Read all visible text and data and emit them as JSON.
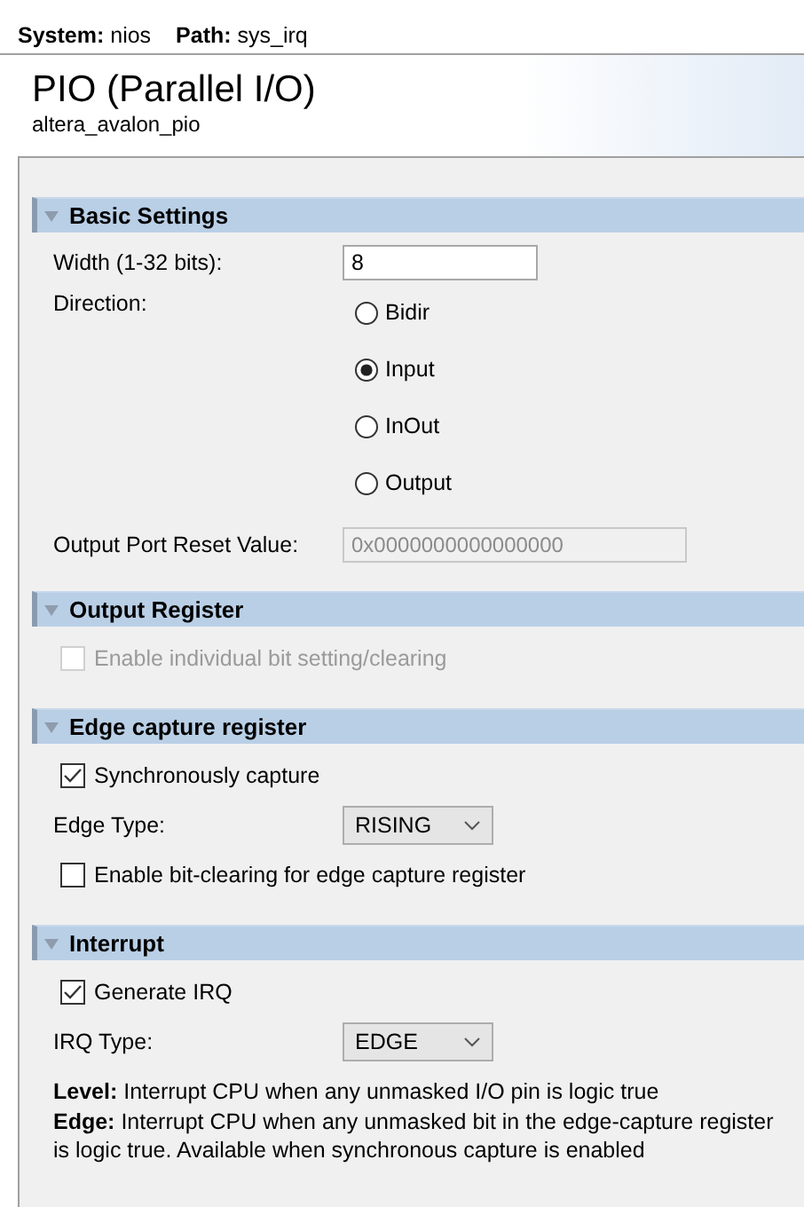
{
  "breadcrumb": [
    {
      "label": "System:",
      "value": "nios"
    },
    {
      "label": "Path:",
      "value": "sys_irq"
    }
  ],
  "component": {
    "title": "PIO (Parallel I/O)",
    "subtitle": "altera_avalon_pio"
  },
  "sections": [
    {
      "title": "Basic Settings",
      "expanded": true,
      "items": [
        {
          "kind": "text",
          "label": "Width (1-32 bits):",
          "value": "8",
          "disabled": false
        },
        {
          "kind": "radio",
          "label": "Direction:",
          "options": [
            {
              "label": "Bidir",
              "selected": false
            },
            {
              "label": "Input",
              "selected": true
            },
            {
              "label": "InOut",
              "selected": false
            },
            {
              "label": "Output",
              "selected": false
            }
          ]
        },
        {
          "kind": "text",
          "label": "Output Port Reset Value:",
          "value": "0x0000000000000000",
          "disabled": true
        }
      ]
    },
    {
      "title": "Output Register",
      "expanded": true,
      "items": [
        {
          "kind": "checkbox",
          "label": "Enable individual bit setting/clearing",
          "checked": false,
          "disabled": true
        }
      ]
    },
    {
      "title": "Edge capture register",
      "expanded": true,
      "items": [
        {
          "kind": "checkbox",
          "label": "Synchronously capture",
          "checked": true,
          "disabled": false
        },
        {
          "kind": "select",
          "label": "Edge Type:",
          "value": "RISING"
        },
        {
          "kind": "checkbox",
          "label": "Enable bit-clearing for edge capture register",
          "checked": false,
          "disabled": false
        }
      ]
    },
    {
      "title": "Interrupt",
      "expanded": true,
      "items": [
        {
          "kind": "checkbox",
          "label": "Generate IRQ",
          "checked": true,
          "disabled": false
        },
        {
          "kind": "select",
          "label": "IRQ Type:",
          "value": "EDGE"
        },
        {
          "kind": "note",
          "lines": [
            "**Level:** Interrupt CPU when any unmasked I/O pin is logic true",
            "**Edge:** Interrupt CPU when any unmasked bit in the edge-capture register is logic true. Available when synchronous capture is enabled"
          ]
        }
      ]
    }
  ]
}
